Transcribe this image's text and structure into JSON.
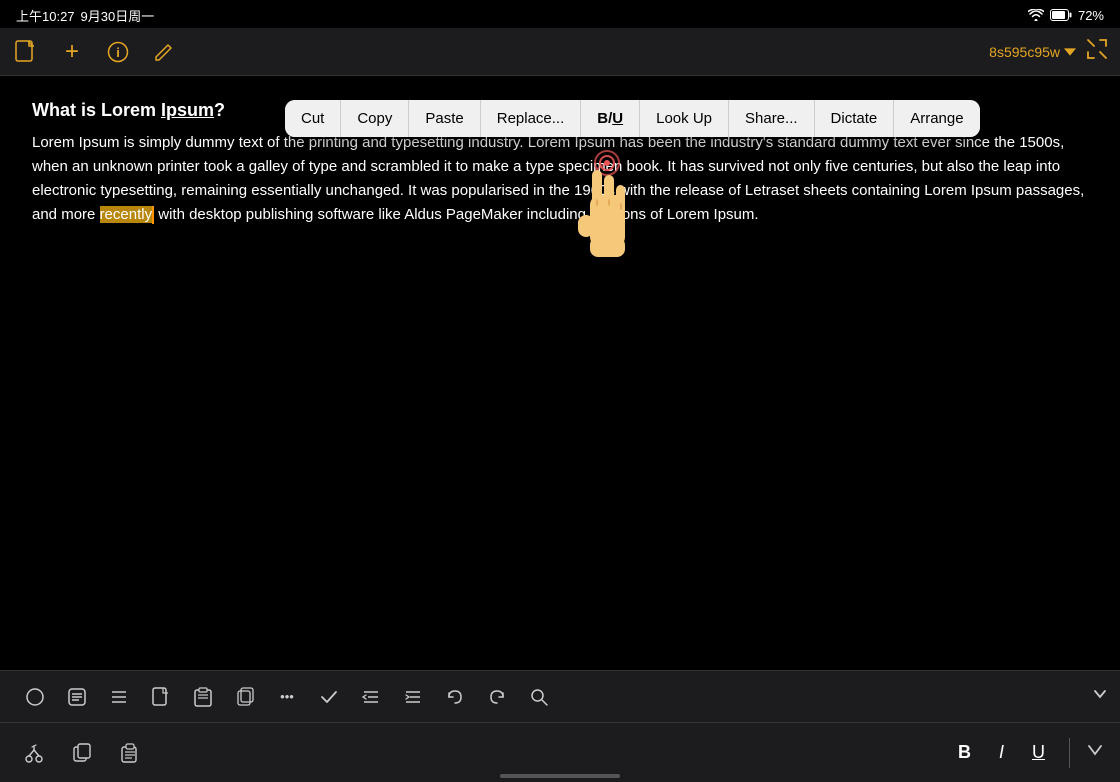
{
  "statusBar": {
    "time": "上午10:27",
    "date": "9月30日周一",
    "wifi": "wifi-icon",
    "battery": "battery-icon",
    "batteryLevel": "72%"
  },
  "topToolbar": {
    "newDocIcon": "📄",
    "addIcon": "+",
    "infoIcon": "ℹ",
    "editIcon": "✏️",
    "docId": "8s595c95w",
    "dropdownIcon": "chevron-down",
    "fullscreenIcon": "fullscreen"
  },
  "content": {
    "title": "What is Lorem Ipsum?",
    "titleUnderlinedWord": "Ipsum",
    "body": "Lorem Ipsum is simply dummy text of the printing and typesetting industry. Lorem Ipsum has been the industry's standard dummy text ever since the 1500s, when an unknown printer took a galley of type and scrambled it to make a type specimen book. It has survived not only five centuries, but also the leap into electronic typesetting, remaining essentially unchanged. It was popularised in the 1960s with the release of Letraset sheets containing Lorem Ipsum passages, and more recently with desktop publishing software like Aldus PageMaker including versions of Lorem Ipsum.",
    "highlightedWord": "recently"
  },
  "contextMenu": {
    "items": [
      "Cut",
      "Copy",
      "Paste",
      "Replace...",
      "B/U",
      "Look Up",
      "Share...",
      "Dictate",
      "Arrange"
    ]
  },
  "bottomToolbar": {
    "icons": [
      "○",
      "⊡",
      "☰",
      "📄",
      "📋",
      "⧉",
      "✓",
      "⊟",
      "⊞",
      "↩",
      "↪",
      "🔍"
    ],
    "expandIcon": "chevron-down"
  },
  "footerBar": {
    "cutIcon": "cut",
    "copyIcon": "copy",
    "pasteIcon": "paste",
    "boldLabel": "B",
    "italicLabel": "I",
    "underlineLabel": "U",
    "chevronDown": "chevron-down"
  }
}
